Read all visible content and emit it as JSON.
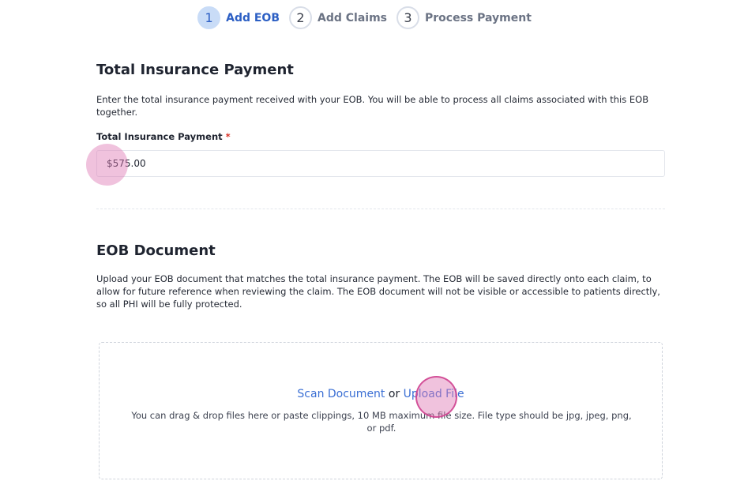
{
  "stepper": {
    "steps": [
      {
        "num": "1",
        "label": "Add EOB"
      },
      {
        "num": "2",
        "label": "Add Claims"
      },
      {
        "num": "3",
        "label": "Process Payment"
      }
    ]
  },
  "payment_section": {
    "title": "Total Insurance Payment",
    "description": "Enter the total insurance payment received with your EOB. You will be able to process all claims associated with this EOB together.",
    "field_label": "Total Insurance Payment",
    "required_mark": "*",
    "value": "$575.00"
  },
  "eob_section": {
    "title": "EOB Document",
    "description": "Upload your EOB document that matches the total insurance payment. The EOB will be saved directly onto each claim, to allow for future reference when reviewing the claim. The EOB document will not be visible or accessible to patients directly, so all PHI will be fully protected.",
    "scan_label": "Scan Document",
    "or_text": "or",
    "upload_label": "Upload File",
    "hint": "You can drag & drop files here or paste clippings, 10 MB maximum file size. File type should be jpg, jpeg, png, or pdf."
  },
  "colors": {
    "accent": "#3b6fd4",
    "active_step_bg": "#c9dcf7",
    "required": "#d93025",
    "touch_indicator": "#de78b4"
  }
}
